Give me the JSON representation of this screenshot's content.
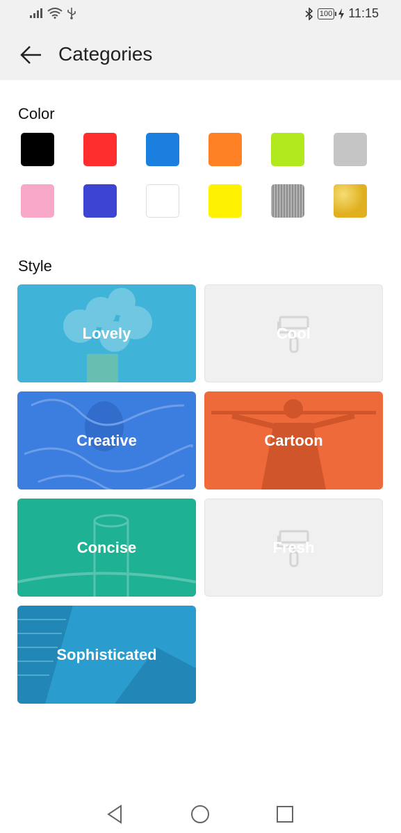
{
  "status_bar": {
    "battery_text": "100",
    "time": "11:15"
  },
  "app_bar": {
    "title": "Categories"
  },
  "color_section": {
    "title": "Color",
    "swatches": [
      {
        "name": "black",
        "color": "#000000"
      },
      {
        "name": "red",
        "color": "#ff2e2e"
      },
      {
        "name": "blue",
        "color": "#1b7fe0"
      },
      {
        "name": "orange",
        "color": "#ff8126"
      },
      {
        "name": "lime",
        "color": "#b2e81e"
      },
      {
        "name": "light-gray",
        "color": "#c5c5c5"
      },
      {
        "name": "pink",
        "color": "#f7a8c8"
      },
      {
        "name": "indigo",
        "color": "#3d44d1"
      },
      {
        "name": "white",
        "color": "#ffffff"
      },
      {
        "name": "yellow",
        "color": "#fff200"
      },
      {
        "name": "silver",
        "color": "#9a9a9a"
      },
      {
        "name": "gold",
        "color": "#e0b020"
      }
    ]
  },
  "style_section": {
    "title": "Style",
    "cards": [
      {
        "label": "Lovely",
        "color": "#40b4d8",
        "placeholder": false
      },
      {
        "label": "Cool",
        "color": "#f0f0f0",
        "placeholder": true
      },
      {
        "label": "Creative",
        "color": "#3b7ee0",
        "placeholder": false
      },
      {
        "label": "Cartoon",
        "color": "#ef6a3a",
        "placeholder": false
      },
      {
        "label": "Concise",
        "color": "#1eb193",
        "placeholder": false
      },
      {
        "label": "Fresh",
        "color": "#f0f0f0",
        "placeholder": true
      },
      {
        "label": "Sophisticated",
        "color": "#2a9ccd",
        "placeholder": false
      }
    ]
  }
}
